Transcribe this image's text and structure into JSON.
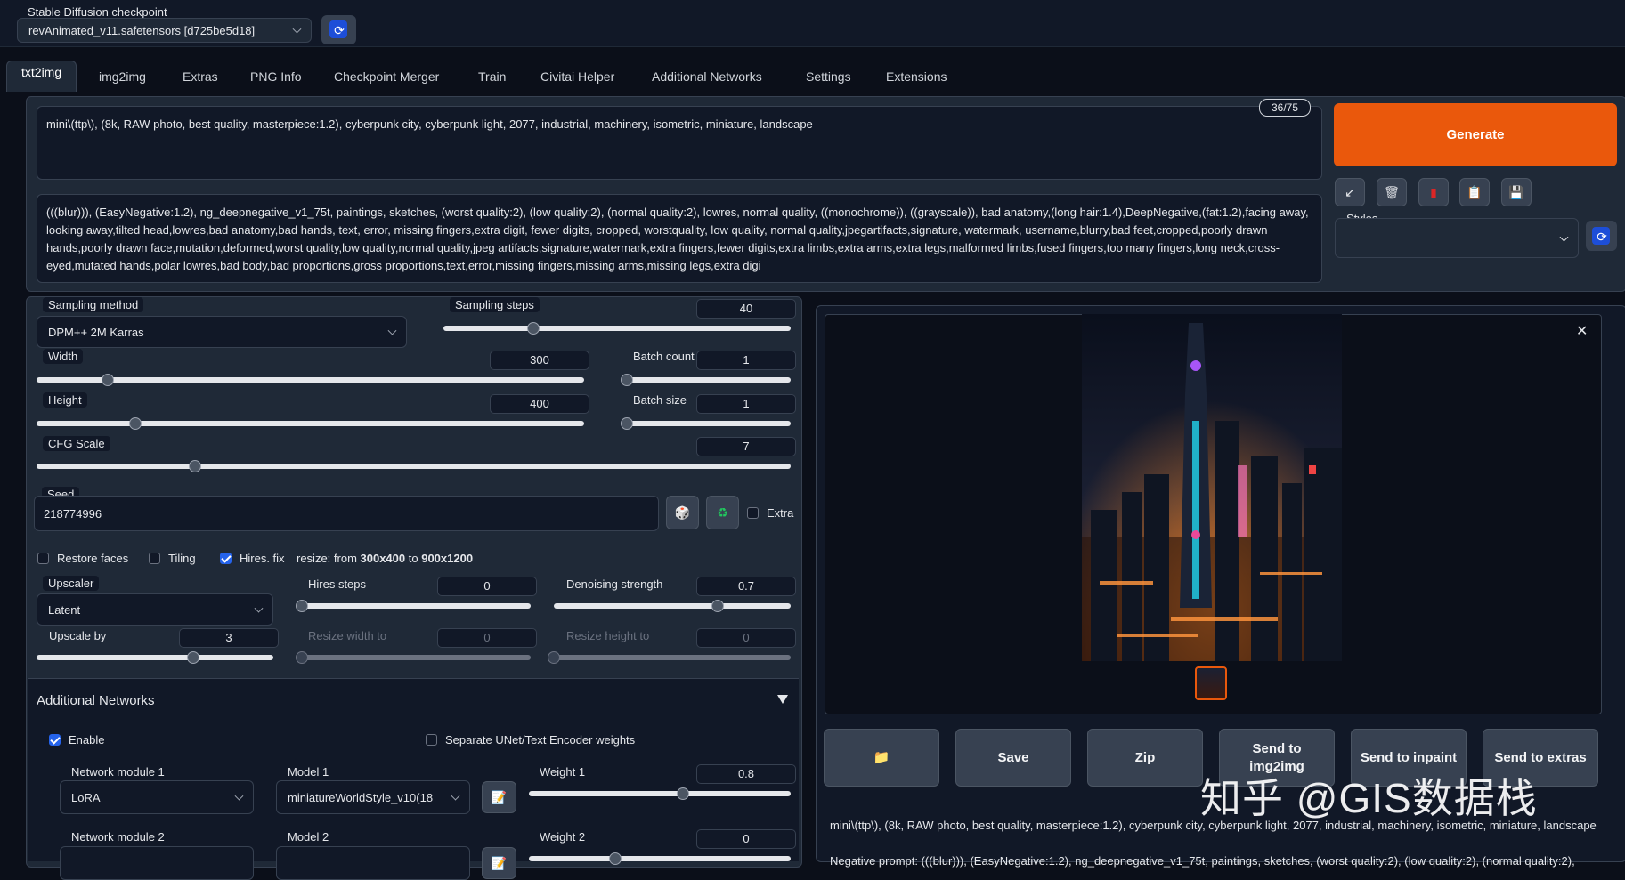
{
  "checkpoint": {
    "label": "Stable Diffusion checkpoint",
    "value": "revAnimated_v11.safetensors [d725be5d18]"
  },
  "tabs": [
    "txt2img",
    "img2img",
    "Extras",
    "PNG Info",
    "Checkpoint Merger",
    "Train",
    "Civitai Helper",
    "Additional Networks",
    "Settings",
    "Extensions"
  ],
  "prompt": {
    "text": "mini\\(ttp\\), (8k, RAW photo, best quality, masterpiece:1.2), cyberpunk city, cyberpunk light, 2077, industrial, machinery, isometric, miniature, landscape",
    "token_count": "36/75"
  },
  "negative_prompt": {
    "text": "(((blur))), (EasyNegative:1.2), ng_deepnegative_v1_75t, paintings, sketches, (worst quality:2), (low quality:2), (normal quality:2), lowres, normal quality, ((monochrome)), ((grayscale)), bad anatomy,(long hair:1.4),DeepNegative,(fat:1.2),facing away, looking away,tilted head,lowres,bad anatomy,bad hands, text, error, missing fingers,extra digit, fewer digits, cropped, worstquality, low quality, normal quality,jpegartifacts,signature, watermark, username,blurry,bad feet,cropped,poorly drawn hands,poorly drawn face,mutation,deformed,worst quality,low quality,normal quality,jpeg artifacts,signature,watermark,extra fingers,fewer digits,extra limbs,extra arms,extra legs,malformed limbs,fused fingers,too many fingers,long neck,cross-eyed,mutated hands,polar lowres,bad body,bad proportions,gross proportions,text,error,missing fingers,missing arms,missing legs,extra digi"
  },
  "generate_label": "Generate",
  "styles_label": "Styles",
  "tool_icons": [
    "arrow-icon",
    "trash-icon",
    "red-card-icon",
    "clipboard-icon",
    "save-icon"
  ],
  "sampling": {
    "method_label": "Sampling method",
    "method_value": "DPM++ 2M Karras",
    "steps_label": "Sampling steps",
    "steps_value": "40"
  },
  "width": {
    "label": "Width",
    "value": "300"
  },
  "height": {
    "label": "Height",
    "value": "400"
  },
  "batch_count": {
    "label": "Batch count",
    "value": "1"
  },
  "batch_size": {
    "label": "Batch size",
    "value": "1"
  },
  "cfg": {
    "label": "CFG Scale",
    "value": "7"
  },
  "seed": {
    "label": "Seed",
    "value": "218774996",
    "extra_label": "Extra"
  },
  "options": {
    "restore_faces": "Restore faces",
    "tiling": "Tiling",
    "hires_fix": "Hires. fix",
    "resize_prefix": "resize: from ",
    "resize_from": "300x400",
    "resize_mid": " to ",
    "resize_to": "900x1200"
  },
  "hires": {
    "upscaler_label": "Upscaler",
    "upscaler_value": "Latent",
    "hires_steps_label": "Hires steps",
    "hires_steps_value": "0",
    "denoising_label": "Denoising strength",
    "denoising_value": "0.7",
    "upscale_by_label": "Upscale by",
    "upscale_by_value": "3",
    "resize_width_label": "Resize width to",
    "resize_width_value": "0",
    "resize_height_label": "Resize height to",
    "resize_height_value": "0"
  },
  "slider_levels": {
    "sampling_steps": 0.26,
    "width": 0.13,
    "height": 0.18,
    "batch_count": 0.0,
    "batch_size": 0.0,
    "cfg": 0.21,
    "hires_steps": 0.0,
    "denoising": 0.69,
    "upscale_by": 0.66,
    "resize_width": 0.0,
    "resize_height": 0.0,
    "weight1": 0.59,
    "weight2": 0.33
  },
  "additional_networks": {
    "title": "Additional Networks",
    "enable_label": "Enable",
    "separate_label": "Separate UNet/Text Encoder weights",
    "module1_label": "Network module 1",
    "module1_value": "LoRA",
    "model1_label": "Model 1",
    "model1_value": "miniatureWorldStyle_v10(18",
    "weight1_label": "Weight 1",
    "weight1_value": "0.8",
    "module2_label": "Network module 2",
    "model2_label": "Model 2",
    "weight2_label": "Weight 2",
    "weight2_value": "0"
  },
  "output_buttons": {
    "folder_icon": "📁",
    "save": "Save",
    "zip": "Zip",
    "send_img2img": "Send to img2img",
    "send_inpaint": "Send to inpaint",
    "send_extras": "Send to extras"
  },
  "output_info": {
    "prompt": "mini\\(ttp\\), (8k, RAW photo, best quality, masterpiece:1.2), cyberpunk city, cyberpunk light, 2077, industrial, machinery, isometric, miniature, landscape",
    "negative": "Negative prompt: (((blur))), (EasyNegative:1.2), ng_deepnegative_v1_75t, paintings, sketches, (worst quality:2), (low quality:2), (normal quality:2),"
  },
  "watermark": "知乎 @GIS数据栈",
  "colors": {
    "accent": "#ea580c",
    "background": "#0b0f19",
    "panel": "#1f2937",
    "check": "#2563eb"
  }
}
